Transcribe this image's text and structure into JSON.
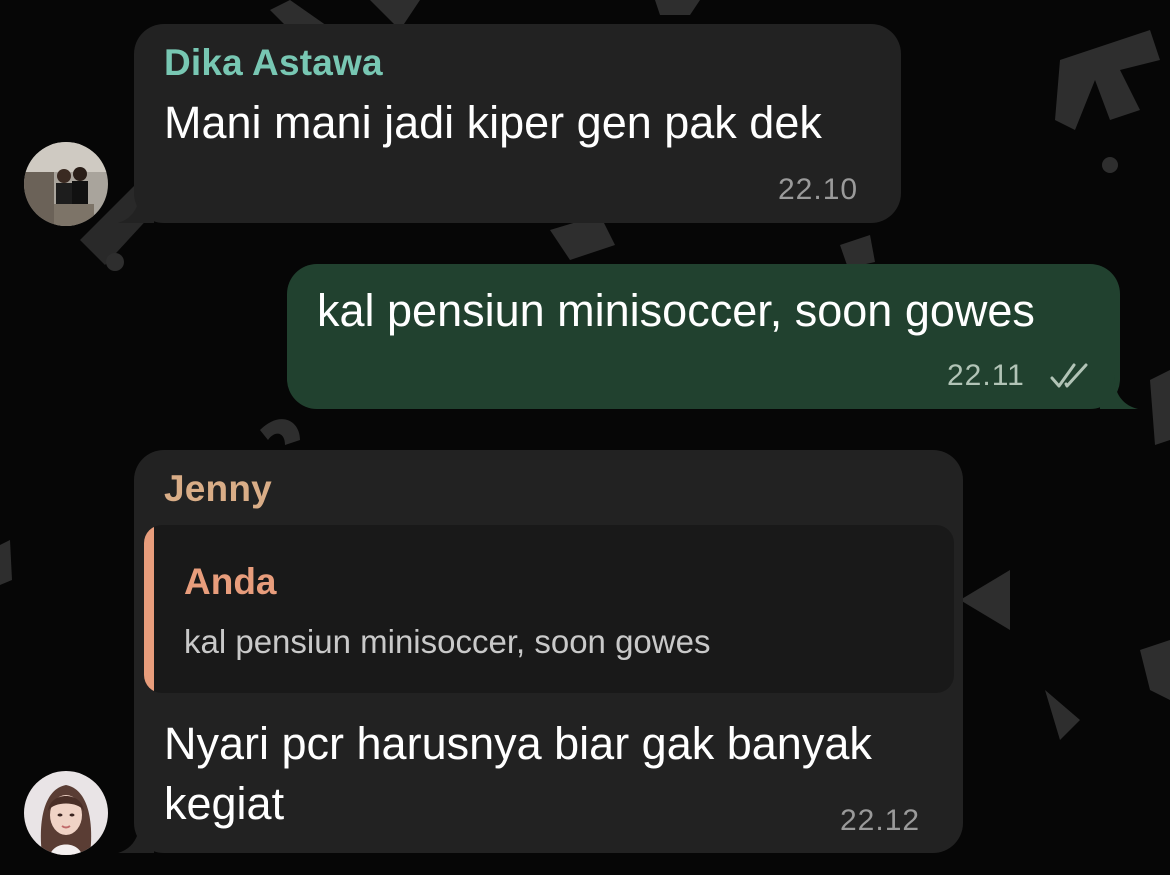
{
  "colors": {
    "incoming_bubble": "#222222",
    "outgoing_bubble": "#21412f",
    "sender_dika": "#78c7b3",
    "sender_jenny": "#d9ad87",
    "reply_accent": "#e89d7c"
  },
  "messages": [
    {
      "direction": "incoming",
      "sender": "Dika Astawa",
      "text": "Mani mani jadi kiper gen pak dek",
      "time": "22.10",
      "avatar": "avatar-dika"
    },
    {
      "direction": "outgoing",
      "text": "kal pensiun minisoccer, soon gowes",
      "time": "22.11",
      "status_icon": "double-check-icon"
    },
    {
      "direction": "incoming",
      "sender": "Jenny",
      "reply_to": {
        "sender": "Anda",
        "text": "kal pensiun minisoccer, soon gowes"
      },
      "text_lines": [
        "Nyari pcr harusnya biar gak banyak",
        "kegiat"
      ],
      "time": "22.12",
      "avatar": "avatar-jenny"
    }
  ]
}
